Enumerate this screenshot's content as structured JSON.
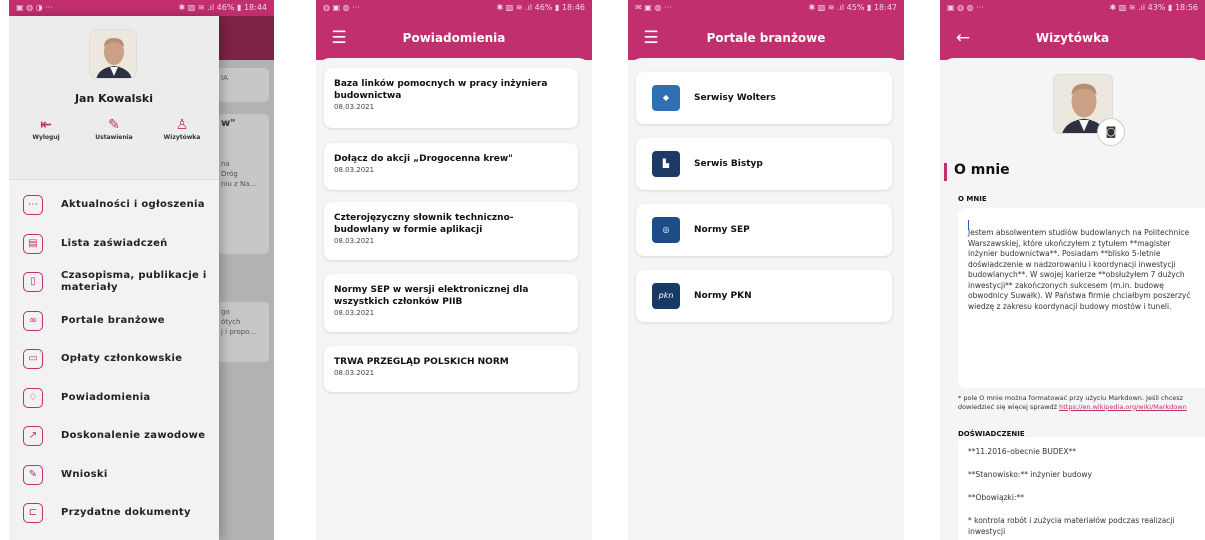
{
  "screen1": {
    "status": {
      "left": "▣ ◍ ◑ ···",
      "right": "✱ ▧ ≋ .ıl 46% ▮ 18:44"
    },
    "background_cards": [
      {
        "text": "IA"
      },
      {
        "text": "w\""
      },
      {
        "text": "na\nDróg\nniu z Na..."
      },
      {
        "text": "go\nótych\nj i propo..."
      }
    ],
    "user_name": "Jan Kowalski",
    "actions": [
      {
        "label": "Wyloguj",
        "icon": "logout-icon"
      },
      {
        "label": "Ustawienia",
        "icon": "pencil-icon"
      },
      {
        "label": "Wizytówka",
        "icon": "person-icon"
      }
    ],
    "menu": [
      {
        "label": "Aktualności i ogłoszenia",
        "icon": "chat-icon"
      },
      {
        "label": "Lista zaświadczeń",
        "icon": "certificate-icon"
      },
      {
        "label": "Czasopisma, publikacje i materiały",
        "icon": "book-icon"
      },
      {
        "label": "Portale branżowe",
        "icon": "link-icon"
      },
      {
        "label": "Opłaty członkowskie",
        "icon": "wallet-icon"
      },
      {
        "label": "Powiadomienia",
        "icon": "bell-icon"
      },
      {
        "label": "Doskonalenie zawodowe",
        "icon": "trend-icon"
      },
      {
        "label": "Wnioski",
        "icon": "pencil-icon"
      },
      {
        "label": "Przydatne dokumenty",
        "icon": "folder-icon"
      }
    ]
  },
  "screen2": {
    "status": {
      "left": "◍ ▣ ◍ ···",
      "right": "✱ ▧ ≋ .ıl 46% ▮ 18:46"
    },
    "title": "Powiadomienia",
    "items": [
      {
        "title": "Baza linków pomocnych w pracy inżyniera budownictwa",
        "date": "08.03.2021"
      },
      {
        "title": "Dołącz do akcji „Drogocenna krew\"",
        "date": "08.03.2021"
      },
      {
        "title": "Czterojęzyczny słownik techniczno-budowlany w formie aplikacji",
        "date": "08.03.2021"
      },
      {
        "title": "Normy SEP w wersji elektronicznej dla wszystkich członków PIIB",
        "date": "08.03.2021"
      },
      {
        "title": "TRWA PRZEGLĄD POLSKICH NORM",
        "date": "08.03.2021"
      }
    ]
  },
  "screen3": {
    "status": {
      "left": "✉ ▣ ◍ ···",
      "right": "✱ ▧ ≋ .ıl 45% ▮ 18:47"
    },
    "title": "Portale branżowe",
    "items": [
      {
        "label": "Serwisy Wolters",
        "logo": "◆",
        "logo_color": "#2f6fb3"
      },
      {
        "label": "Serwis Bistyp",
        "logo": "▙",
        "logo_color": "#1d3a66"
      },
      {
        "label": "Normy SEP",
        "logo": "◎",
        "logo_color": "#1c4d86"
      },
      {
        "label": "Normy PKN",
        "logo": "pkn",
        "logo_color": "#163a63"
      }
    ]
  },
  "screen4": {
    "status": {
      "left": "▣ ◍ ◍ ···",
      "right": "✱ ▧ ≋ .ıl 43% ▮ 18:56"
    },
    "title": "Wizytówka",
    "about_heading": "O mnie",
    "about_label": "O MNIE",
    "about_text": "Jestem absolwentem studiów budowlanych na Politechnice Warszawskiej, które ukończyłem z tytułem **magister inżynier budownictwa**. Posiadam **blisko 5-letnie doświadczenie w nadzorowaniu i koordynacji inwestycji budowlanych**. W swojej karierze **obsłużyłem 7 dużych inwestycji** zakończonych sukcesem (m.in. budowę obwodnicy Suwałk). W Państwa firmie chciałbym poszerzyć wiedzę z zakresu koordynacji budowy mostów i tuneli.",
    "hint_text": "* pole O mnie można formatować przy użyciu Markdown. Jeśli chcesz dowiedzieć się więcej sprawdź ",
    "hint_link": "https://en.wikipedia.org/wiki/Markdown",
    "experience_label": "DOŚWIADCZENIE",
    "experience_lines": [
      "**11.2016–obecnie BUDEX**",
      "**Stanowisko:** inżynier budowy",
      "**Obowiązki:**",
      "*  kontrola robót i zużycia materiałów podczas realizacji inwestycji"
    ]
  },
  "colors": {
    "brand": "#c22f6e",
    "drawer_bg": "#f2f2f2",
    "sheet_bg": "#f5f5f5"
  }
}
